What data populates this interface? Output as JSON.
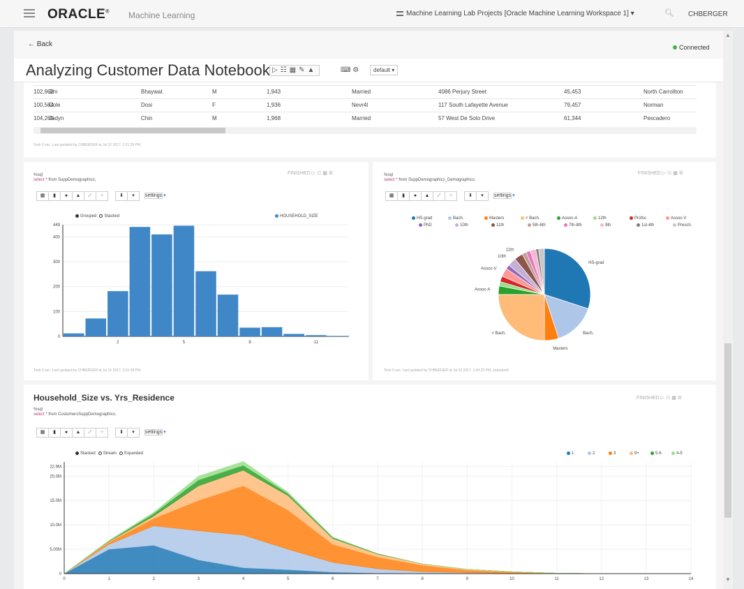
{
  "header": {
    "logo": "ORACLE",
    "product": "Machine Learning",
    "project_menu": "Machine Learning Lab Projects [Oracle Machine Learning Workspace 1]",
    "user": "CHBERGER"
  },
  "nav": {
    "back_label": "Back",
    "connection_status": "Connected",
    "connection_color": "#3cb44b"
  },
  "notebook": {
    "title": "Analyzing Customer Data Notebook",
    "toolbar_icons": [
      "run-icon",
      "list-icon",
      "grid-icon",
      "edit-icon",
      "export-icon"
    ],
    "interpreter": "default"
  },
  "table": {
    "rows": [
      [
        "102,962",
        "Jim",
        "Bhaywat",
        "M",
        "1,943",
        "Married",
        "4086 Perjury Street",
        "45,453",
        "North Carrollton"
      ],
      [
        "100,564",
        "Cole",
        "Dosi",
        "F",
        "1,936",
        "Nevr4l",
        "117 South Lafayette Avenue",
        "79,457",
        "Norman"
      ],
      [
        "104,265",
        "Jadyn",
        "Chin",
        "M",
        "1,968",
        "Married",
        "57 West De Soto Drive",
        "61,344",
        "Pescadero"
      ]
    ],
    "footer": "Took 0 sec. Last updated by CHBERGER at Jul 31 2017, 2:21:39 PM."
  },
  "hist_panel": {
    "sql_interp": "%sql",
    "sql_kw": "select",
    "sql_rest": " * from SuppDemographics;",
    "status": "FINISHED",
    "settings_label": "settings",
    "grouped_label": "Grouped",
    "stacked_label": "Stacked",
    "footer": "Took 0 sec. Last updated by CHBERGER at Jul 31 2017, 2:21:39 PM."
  },
  "pie_panel": {
    "sql_interp": "%sql",
    "sql_kw": "select",
    "sql_rest": " * from SuppDemographics_Demographics;",
    "status": "FINISHED",
    "settings_label": "settings",
    "footer": "Took 0 sec. Last updated by CHBERGER at Jul 31 2017, 1:44:22 PM. (outdated)"
  },
  "area_panel": {
    "title": "Household_Size vs. Yrs_Residence",
    "sql_interp": "%sql",
    "sql_kw": "select",
    "sql_rest": " * from CustomersSuppDemographics;",
    "status": "FINISHED",
    "settings_label": "settings",
    "stacked_label": "Stacked",
    "stream_label": "Stream",
    "expanded_label": "Expanded"
  },
  "chart_data": [
    {
      "type": "bar",
      "series": [
        {
          "name": "HOUSEHOLD_SIZE",
          "color": "#3f87c7"
        }
      ],
      "x": [
        0,
        1,
        2,
        3,
        4,
        5,
        6,
        7,
        8,
        9,
        10,
        11,
        12
      ],
      "values": [
        12,
        72,
        182,
        440,
        410,
        445,
        262,
        168,
        35,
        37,
        10,
        5,
        2
      ],
      "yticks": [
        "0",
        "100",
        "200",
        "300",
        "400",
        "449"
      ],
      "xticks": [
        {
          "x": 2,
          "label": "2"
        },
        {
          "x": 5,
          "label": "5"
        },
        {
          "x": 8,
          "label": "8"
        },
        {
          "x": 11,
          "label": "11"
        }
      ],
      "ylim": [
        0,
        449
      ],
      "grid": true,
      "legend": "top-right"
    },
    {
      "type": "pie",
      "legend_items": [
        {
          "label": "HS-grad",
          "color": "#1f77b4"
        },
        {
          "label": "Bach.",
          "color": "#aec7e8"
        },
        {
          "label": "Masters",
          "color": "#ff7f0e"
        },
        {
          "label": "< Bach.",
          "color": "#ffbb78"
        },
        {
          "label": "Assoc-A",
          "color": "#2ca02c"
        },
        {
          "label": "12th",
          "color": "#98df8a"
        },
        {
          "label": "Profsc",
          "color": "#d62728"
        },
        {
          "label": "Assoc-V",
          "color": "#ff9896"
        },
        {
          "label": "PhD",
          "color": "#9467bd"
        },
        {
          "label": "10th",
          "color": "#c5b0d5"
        },
        {
          "label": "11th",
          "color": "#8c564b"
        },
        {
          "label": "5th-6th",
          "color": "#c49c94"
        },
        {
          "label": "7th-8th",
          "color": "#e377c2"
        },
        {
          "label": "9th",
          "color": "#f7b6d2"
        },
        {
          "label": "1st-4th",
          "color": "#7f7f7f"
        },
        {
          "label": "Presch.",
          "color": "#c7c7c7"
        }
      ],
      "slices": [
        {
          "label": "HS-grad",
          "value": 30,
          "color": "#1f77b4",
          "show": true
        },
        {
          "label": "Bach.",
          "value": 15,
          "color": "#aec7e8",
          "show": true
        },
        {
          "label": "Masters",
          "value": 5,
          "color": "#ff7f0e",
          "show": true
        },
        {
          "label": "< Bach.",
          "value": 25,
          "color": "#ffbb78",
          "show": true
        },
        {
          "label": "Assoc-A",
          "value": 3,
          "color": "#2ca02c",
          "show": true
        },
        {
          "label": "12th",
          "value": 1.5,
          "color": "#98df8a",
          "show": false
        },
        {
          "label": "Profsc",
          "value": 2,
          "color": "#d62728",
          "show": false
        },
        {
          "label": "Assoc-V",
          "value": 3,
          "color": "#ff9896",
          "show": true
        },
        {
          "label": "PhD",
          "value": 1.5,
          "color": "#9467bd",
          "show": false
        },
        {
          "label": "10th",
          "value": 3,
          "color": "#c5b0d5",
          "show": true
        },
        {
          "label": "11th",
          "value": 3,
          "color": "#8c564b",
          "show": true
        },
        {
          "label": "5th-6th",
          "value": 1.5,
          "color": "#c49c94",
          "show": false
        },
        {
          "label": "7th-8th",
          "value": 1.5,
          "color": "#e377c2",
          "show": false
        },
        {
          "label": "9th",
          "value": 2,
          "color": "#f7b6d2",
          "show": false
        },
        {
          "label": "1st-4th",
          "value": 1,
          "color": "#7f7f7f",
          "show": false
        },
        {
          "label": "Presch.",
          "value": 2,
          "color": "#c7c7c7",
          "show": false
        }
      ]
    },
    {
      "type": "area",
      "x": [
        0,
        1,
        2,
        3,
        4,
        5,
        6,
        7,
        8,
        9,
        10,
        11,
        12,
        13,
        14
      ],
      "series": [
        {
          "name": "1",
          "color": "#1f77b4",
          "values": [
            0,
            5.0,
            5.8,
            2.8,
            1.2,
            0.8,
            0.3,
            0.1,
            0,
            0,
            0,
            0,
            0,
            0,
            0
          ]
        },
        {
          "name": "2",
          "color": "#aec7e8",
          "values": [
            0,
            1.0,
            4.0,
            6.0,
            6.7,
            4.2,
            2.0,
            0.9,
            0.4,
            0.2,
            0.1,
            0,
            0,
            0,
            0
          ]
        },
        {
          "name": "3",
          "color": "#ff7f0e",
          "values": [
            0,
            0.4,
            1.5,
            6.2,
            10.1,
            8.0,
            3.7,
            2.4,
            1.3,
            0.5,
            0.2,
            0.1,
            0,
            0,
            0
          ]
        },
        {
          "name": "9+",
          "color": "#ffbb78",
          "values": [
            0,
            0.2,
            0.5,
            3.0,
            3.2,
            3.0,
            1.2,
            0.6,
            0.3,
            0.2,
            0.1,
            0,
            0,
            0,
            0
          ]
        },
        {
          "name": "5-6",
          "color": "#2ca02c",
          "values": [
            0,
            0.1,
            0.5,
            1.2,
            1.0,
            0.4,
            0.2,
            0.1,
            0,
            0,
            0,
            0,
            0,
            0,
            0
          ]
        },
        {
          "name": "4-5",
          "color": "#98df8a",
          "values": [
            0,
            0.1,
            0.3,
            0.8,
            0.8,
            0.3,
            0.1,
            0,
            0,
            0,
            0,
            0,
            0,
            0,
            0
          ]
        }
      ],
      "yticks": [
        {
          "v": 0,
          "label": "0"
        },
        {
          "v": 5,
          "label": "5.00M"
        },
        {
          "v": 10,
          "label": "10.0M"
        },
        {
          "v": 15,
          "label": "15.0M"
        },
        {
          "v": 20,
          "label": "20.0M"
        },
        {
          "v": 22,
          "label": "22.9M"
        }
      ],
      "xticks": [
        "0",
        "1",
        "2",
        "3",
        "4",
        "5",
        "6",
        "7",
        "8",
        "9",
        "10",
        "11",
        "12",
        "13",
        "14"
      ],
      "ylim": [
        0,
        22.9
      ],
      "grid": true,
      "legend": "top-right"
    }
  ]
}
